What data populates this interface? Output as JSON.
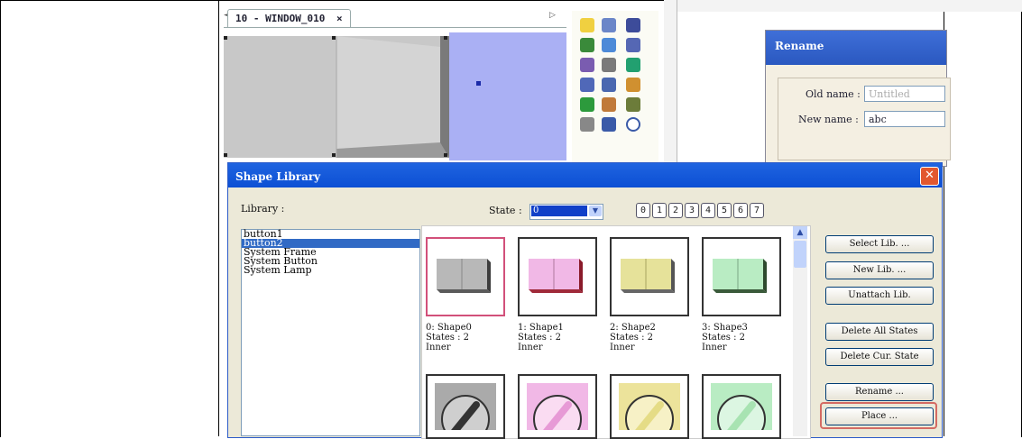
{
  "editor": {
    "tab_label": "10 - WINDOW_010",
    "tab_close": "×",
    "scroll_left": "◄",
    "scroll_right": "▷"
  },
  "rename_dialog": {
    "title": "Rename",
    "old_name_label": "Old name :",
    "old_name_value": "Untitled",
    "new_name_label": "New name :",
    "new_name_value": "abc"
  },
  "shape_library": {
    "title": "Shape Library",
    "close": "✕",
    "library_label": "Library :",
    "library_items": [
      "button1",
      "button2",
      "System Frame",
      "System Button",
      "System Lamp"
    ],
    "selected_library": "button2",
    "state_label": "State :",
    "state_value": "0",
    "state_numbers": [
      "0",
      "1",
      "2",
      "3",
      "4",
      "5",
      "6",
      "7"
    ],
    "shapes": [
      {
        "name": "0: Shape0",
        "states": "States : 2",
        "kind": "Inner",
        "color": "#b8b8b8",
        "shadow": "#3d3d3d"
      },
      {
        "name": "1: Shape1",
        "states": "States : 2",
        "kind": "Inner",
        "color": "#f1b8e6",
        "shadow": "#8a1a2a"
      },
      {
        "name": "2: Shape2",
        "states": "States : 2",
        "kind": "Inner",
        "color": "#e6e29a",
        "shadow": "#555"
      },
      {
        "name": "3: Shape3",
        "states": "States : 2",
        "kind": "Inner",
        "color": "#b9ecc3",
        "shadow": "#2e4a2e"
      }
    ],
    "knob_colors": [
      "#aaaaaa",
      "#f1b8e6",
      "#ece39b",
      "#b9ecc3"
    ],
    "buttons": {
      "select_lib": "Select Lib. ...",
      "new_lib": "New Lib. ...",
      "unattach_lib": "Unattach Lib.",
      "delete_all_states": "Delete All States",
      "delete_cur_state": "Delete Cur. State",
      "rename": "Rename ...",
      "place": "Place ..."
    }
  }
}
